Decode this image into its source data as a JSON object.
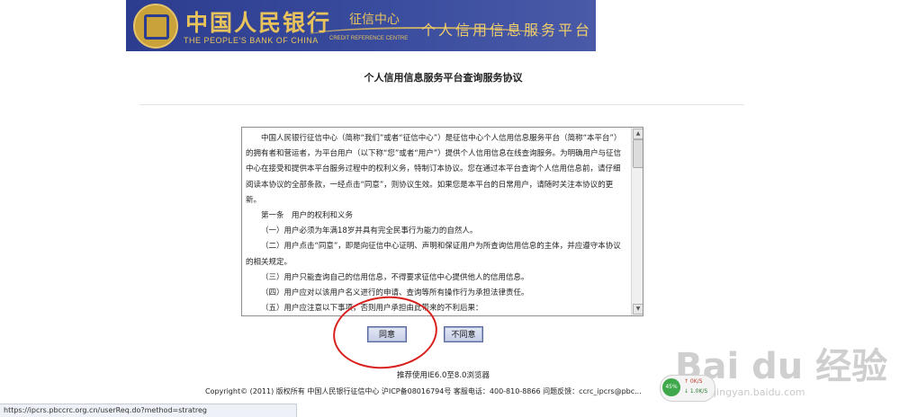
{
  "header": {
    "bank_name_cn": "中国人民银行",
    "center_cn": "征信中心",
    "bank_name_en": "THE PEOPLE'S BANK OF CHINA",
    "center_en": "CREDIT REFERENCE CENTRE",
    "platform_cn": "个人信用信息服务平台"
  },
  "page_title": "个人信用信息服务平台查询服务协议",
  "agreement": {
    "paragraphs": [
      "中国人民银行征信中心（简称“我们”或者“征信中心”）是征信中心个人信用信息服务平台（简称“本平台”）的拥有者和营运者，为平台用户（以下称“您”或者“用户”）提供个人信用信息在线查询服务。为明确用户与征信中心在接受和提供本平台服务过程中的权利义务，特制订本协议。您在通过本平台查询个人信用信息前，请仔细阅读本协议的全部条款，一经点击“同意”，则协议生效。如果您是本平台的日常用户，请随时关注本协议的更新。",
      "第一条　用户的权利和义务",
      "（一）用户必须为年满18岁并具有完全民事行为能力的自然人。",
      "（二）用户点击“同意”，即是向征信中心证明、声明和保证用户为所查询信用信息的主体，并应遵守本协议的相关规定。",
      "（三）用户只能查询自己的信用信息，不得要求征信中心提供他人的信用信息。",
      "（四）用户应对以该用户名义进行的申请、查询等所有操作行为承担法律责任。",
      "（五）用户应注意以下事项，否则用户承担由此带来的不利后果："
    ]
  },
  "buttons": {
    "agree": "同意",
    "disagree": "不同意"
  },
  "footer": {
    "browser_hint": "推荐使用IE6.0至8.0浏览器",
    "copyright": "Copyright© (2011) 版权所有 中国人民银行征信中心 沪ICP备08016794号 客服电话：400-810-8866 问题反馈：ccrc_ipcrs@pbc..."
  },
  "status_bar": {
    "url": "https://ipcrs.pbccrc.org.cn/userReq.do?method=stratreg"
  },
  "net_widget": {
    "percent": "45%",
    "up": "↑ 0K/S",
    "down": "↓ 1.0K/S"
  },
  "watermark": {
    "text": "Bai du 经验",
    "url": "jingyan.baidu.com"
  },
  "colors": {
    "banner": "#2c3c8e",
    "gold": "#e8c35c",
    "annotation_circle": "#d8211c"
  }
}
